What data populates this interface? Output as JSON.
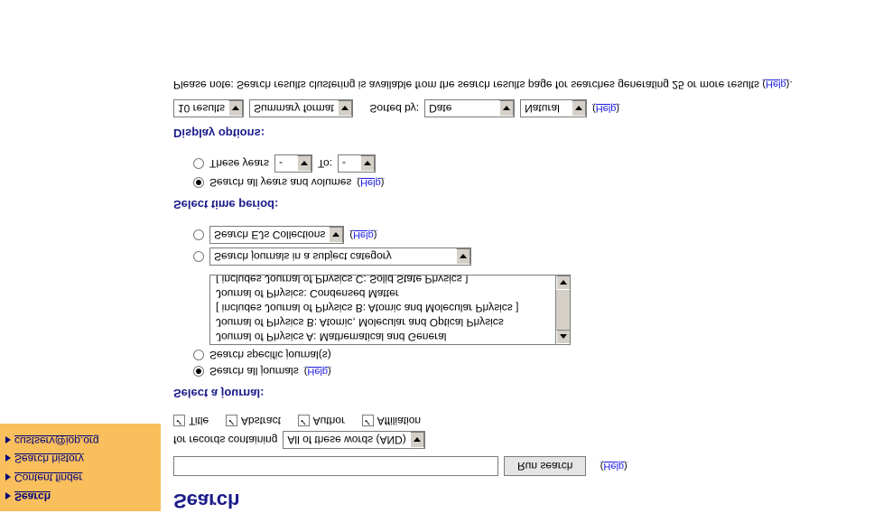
{
  "sidebar": {
    "items": [
      {
        "label": "Search",
        "active": true
      },
      {
        "label": "Content finder",
        "active": false
      },
      {
        "label": "Search history",
        "active": false
      },
      {
        "label": "custserv@iop.org",
        "active": false
      }
    ]
  },
  "page_title": "Search",
  "search": {
    "query": "",
    "run_label": "Run search",
    "help": "Help"
  },
  "containing": {
    "prefix": "for records containing",
    "mode": "All of these words (AND)"
  },
  "fields": {
    "title": {
      "label": "Title",
      "checked": true
    },
    "abstract": {
      "label": "Abstract",
      "checked": true
    },
    "author": {
      "label": "Author",
      "checked": true
    },
    "affiliation": {
      "label": "Affiliation",
      "checked": true
    }
  },
  "journal": {
    "heading": "Select a journal:",
    "all_label": "Search all journals",
    "all_checked": true,
    "specific_label": "Search specific journal(s)",
    "specific_checked": false,
    "list": [
      "Journal of Physics A: Mathematical and General",
      "Journal of Physics B: Atomic, Molecular and Optical Physics",
      "   [ includes Journal of Physics B: Atomic and Molecular Physics ]",
      "Journal of Physics: Condensed Matter",
      "   [ includes Journal of Physics C: Solid State Physics ]"
    ],
    "subject_label": "Search journals in a subject category",
    "subject_checked": false,
    "ej_label": "Search EJs Collections",
    "ej_checked": false,
    "help": "Help"
  },
  "time": {
    "heading": "Select time period:",
    "all_label": "Search all years and volumes",
    "all_checked": true,
    "these_label": "These years",
    "these_checked": false,
    "from": "-",
    "to_label": "To:",
    "to": "-",
    "help": "Help"
  },
  "display": {
    "heading": "Display options:",
    "results": "10 results",
    "format": "Summary format",
    "sorted_by": "Sorted by:",
    "sort_field": "Date",
    "sort_order": "Natural",
    "help": "Help"
  },
  "note": {
    "text_a": "Please note: Search results clustering is available from the search results page for searches generating 25 or more results",
    "help": "Help",
    "tail": "."
  }
}
